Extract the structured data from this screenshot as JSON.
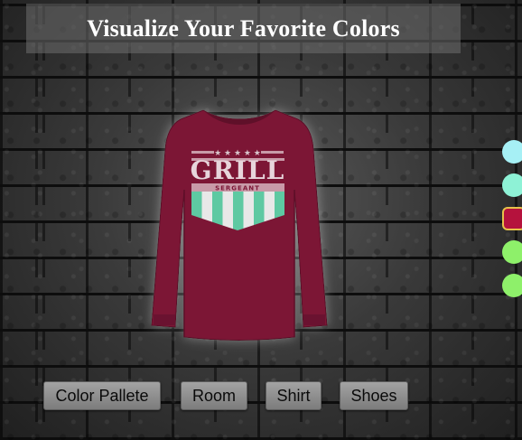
{
  "header": {
    "title": "Visualize Your Favorite Colors"
  },
  "product": {
    "shirt_color": "#7b1636",
    "graphic": {
      "headline": "GRILL",
      "subline": "SERGEANT",
      "stars": "★ ★ ★ ★ ★",
      "stripe_colors": [
        "#5ec9a2",
        "#e8e8e8"
      ]
    }
  },
  "swatches": [
    {
      "color": "#a6f0f5",
      "selected": false
    },
    {
      "color": "#8ef2d6",
      "selected": false
    },
    {
      "color": "#b5123d",
      "selected": true
    },
    {
      "color": "#8ef06a",
      "selected": false
    },
    {
      "color": "#8ef06a",
      "selected": false
    }
  ],
  "toolbar": {
    "color_pallete_label": "Color Pallete",
    "room_label": "Room",
    "shirt_label": "Shirt",
    "shoes_label": "Shoes"
  }
}
